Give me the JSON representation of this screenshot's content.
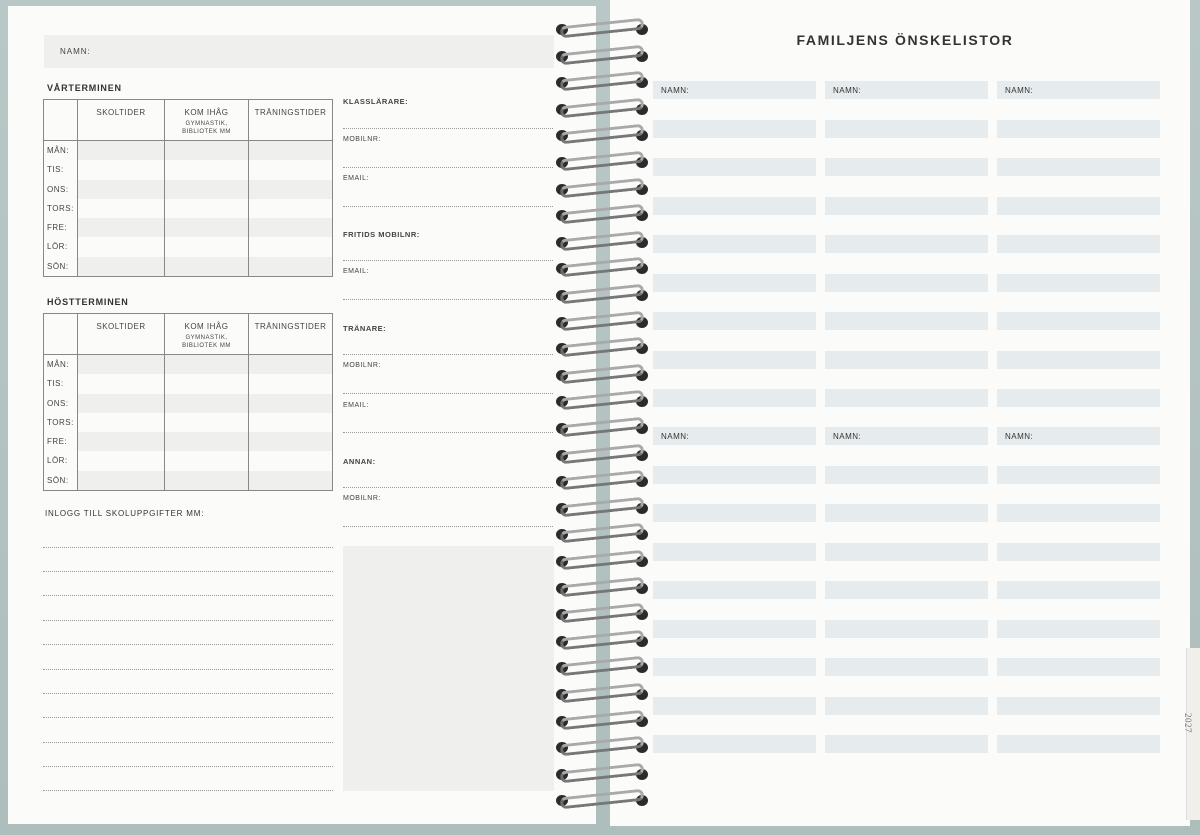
{
  "left_page": {
    "name_label": "NAMN:",
    "spring_term": {
      "title": "VÅRTERMINEN",
      "columns": [
        "SKOLTIDER",
        "KOM IHÅG",
        "TRÄNINGSTIDER"
      ],
      "column_sub": "GYMNASTIK,\nBIBLIOTEK MM",
      "days": [
        "MÅN:",
        "TIS:",
        "ONS:",
        "TORS:",
        "FRE:",
        "LÖR:",
        "SÖN:"
      ]
    },
    "fall_term": {
      "title": "HÖSTTERMINEN",
      "columns": [
        "SKOLTIDER",
        "KOM IHÅG",
        "TRÄNINGSTIDER"
      ],
      "column_sub": "GYMNASTIK,\nBIBLIOTEK MM",
      "days": [
        "MÅN:",
        "TIS:",
        "ONS:",
        "TORS:",
        "FRE:",
        "LÖR:",
        "SÖN:"
      ]
    },
    "contacts": {
      "klasslarare": "KLASSLÄRARE:",
      "mobilnr": "MOBILNR:",
      "email": "EMAIL:",
      "fritids_mobilnr": "FRITIDS MOBILNR:",
      "tranare": "TRÄNARE:",
      "annan": "ANNAN:"
    },
    "login_title": "INLOGG TILL SKOLUPPGIFTER MM:"
  },
  "right_page": {
    "title": "FAMILJENS ÖNSKELISTOR",
    "name_label": "NAMN:",
    "year_tab": "2027"
  }
}
